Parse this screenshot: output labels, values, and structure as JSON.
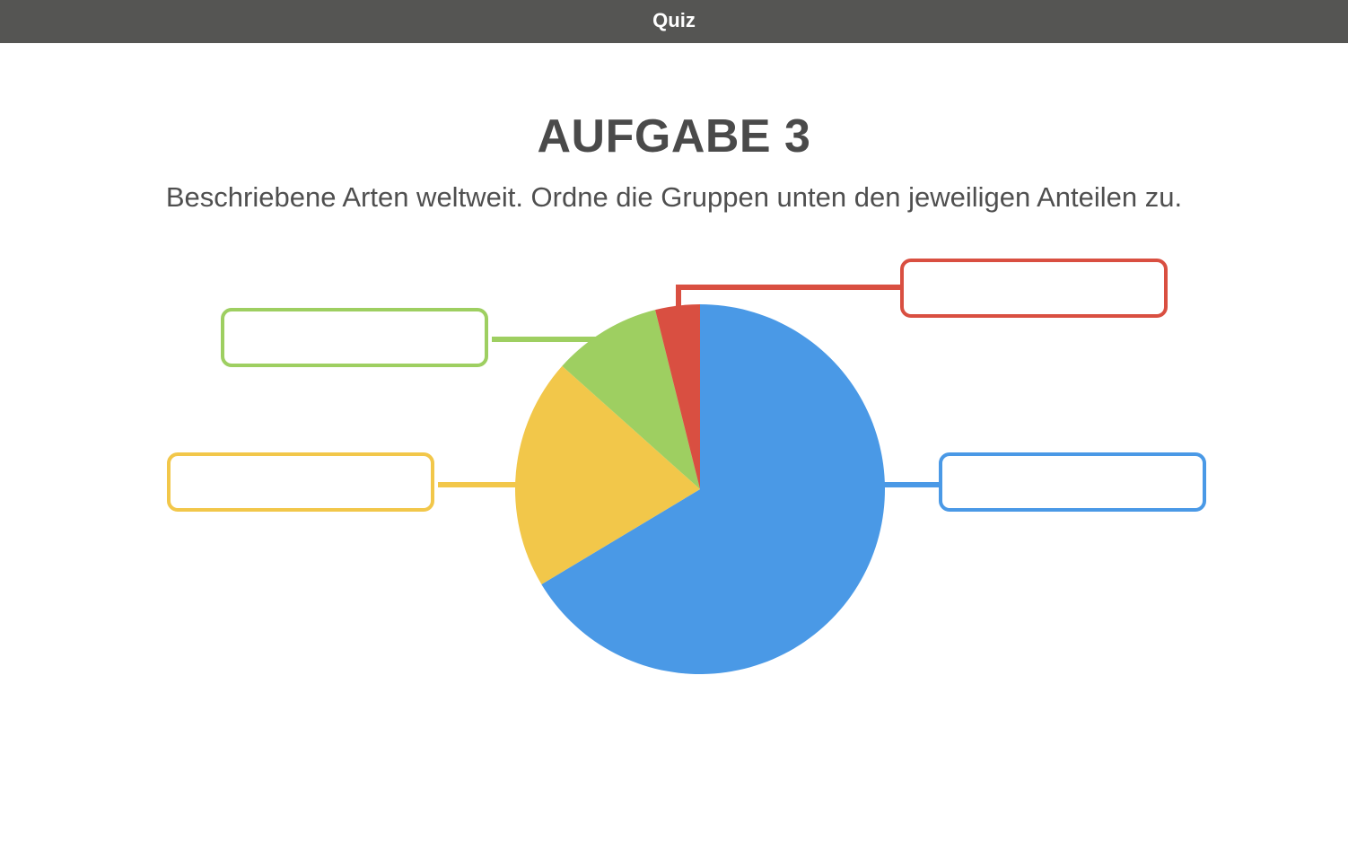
{
  "window": {
    "title": "Quiz"
  },
  "task": {
    "heading": "AUFGABE 3",
    "instruction": "Beschriebene Arten weltweit. Ordne die Gruppen unten den jeweiligen Anteilen zu."
  },
  "chart_data": {
    "type": "pie",
    "slices": [
      {
        "share": 0.664,
        "color": "#4A99E6",
        "answer": ""
      },
      {
        "share": 0.202,
        "color": "#F2C74A",
        "answer": ""
      },
      {
        "share": 0.095,
        "color": "#9ECF61",
        "answer": ""
      },
      {
        "share": 0.039,
        "color": "#D94F41",
        "answer": ""
      }
    ]
  }
}
